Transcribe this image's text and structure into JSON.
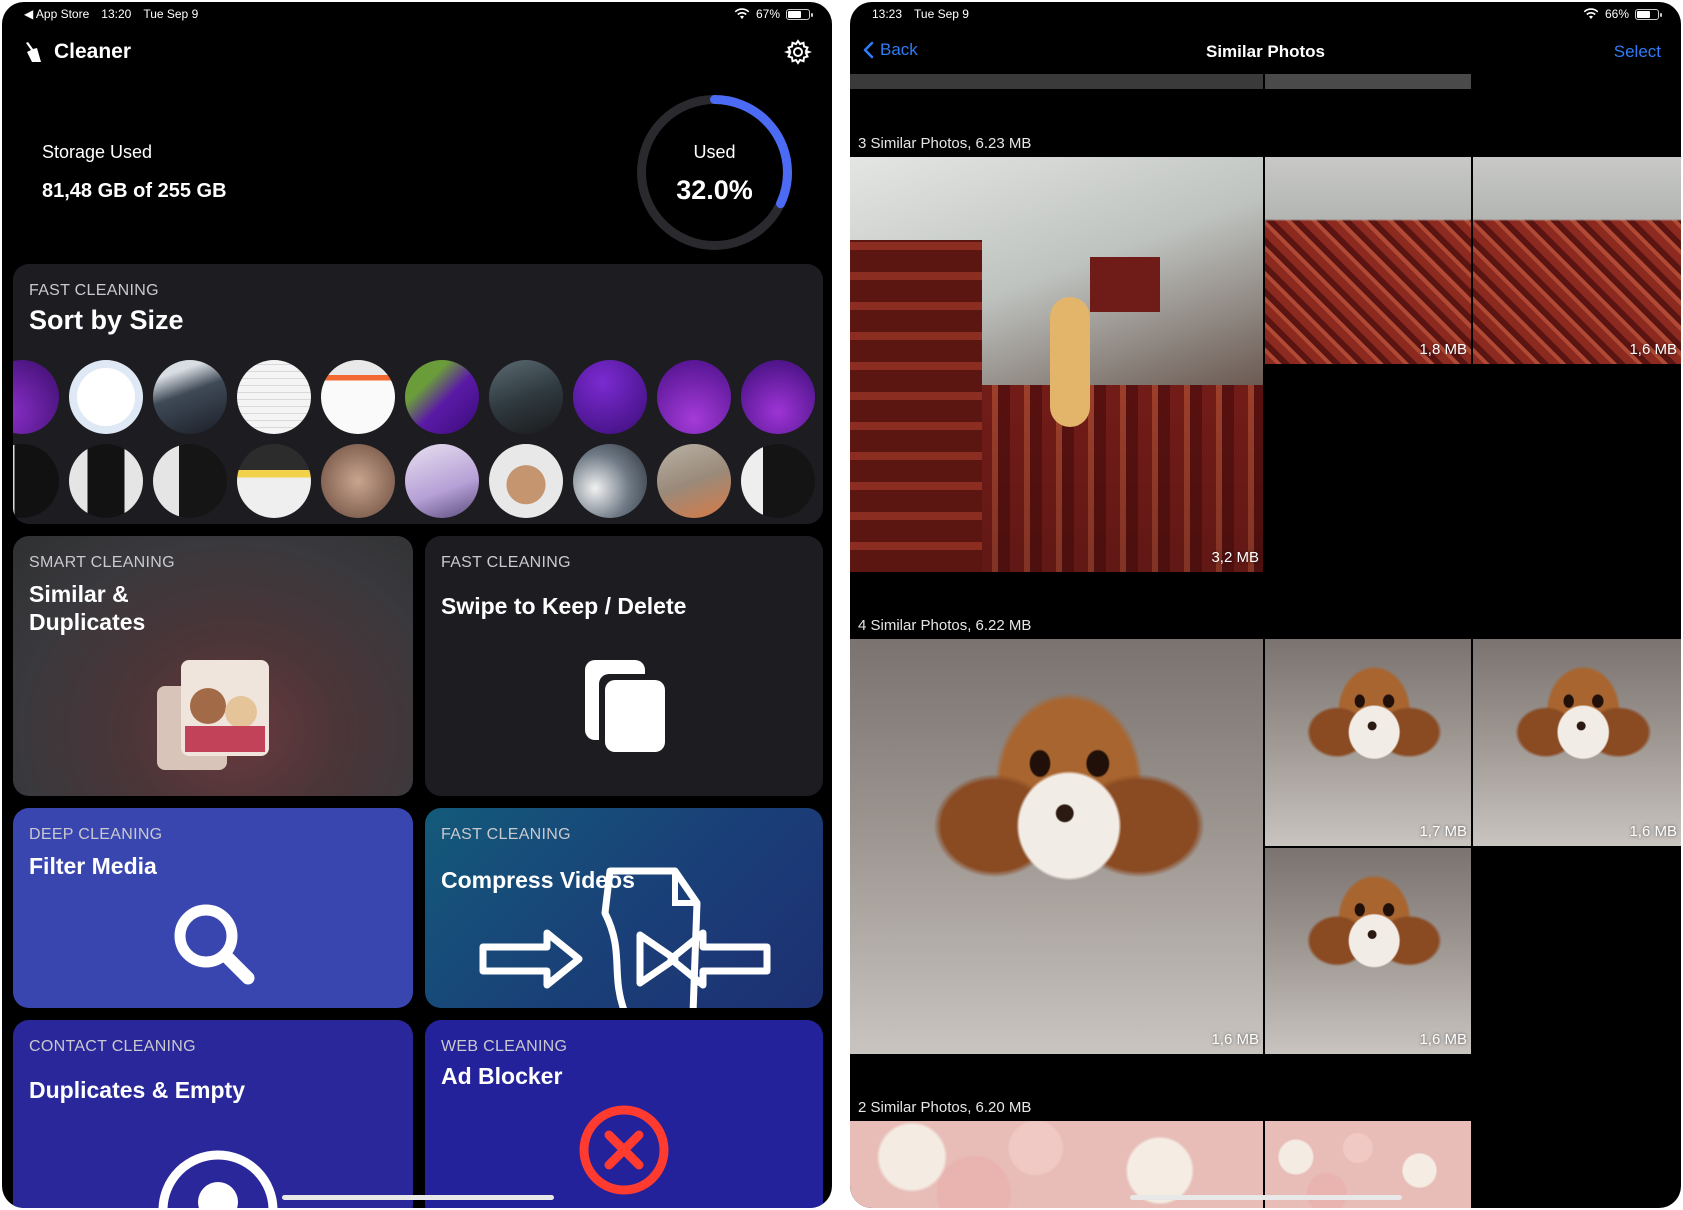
{
  "left": {
    "status": {
      "carrier": "◀ App Store",
      "time": "13:20",
      "date": "Tue Sep 9",
      "battery": "67%",
      "battery_level": 0.67
    },
    "app_title": "Cleaner",
    "storage": {
      "label": "Storage Used",
      "value": "81,48 GB of 255 GB",
      "ring_label": "Used",
      "ring_value": "32.0%",
      "fraction": 0.32
    },
    "sort_card": {
      "category": "FAST CLEANING",
      "title": "Sort by Size"
    },
    "similar_card": {
      "category": "SMART CLEANING",
      "title_line1": "Similar &",
      "title_line2": "Duplicates"
    },
    "swipe_card": {
      "category": "FAST CLEANING",
      "title": "Swipe to Keep / Delete"
    },
    "filter_card": {
      "category": "DEEP CLEANING",
      "title": "Filter Media"
    },
    "compress_card": {
      "category": "FAST CLEANING",
      "title": "Compress Videos"
    },
    "contact_card": {
      "category": "CONTACT CLEANING",
      "title": "Duplicates & Empty"
    },
    "adblock_card": {
      "category": "WEB CLEANING",
      "title": "Ad Blocker"
    }
  },
  "right": {
    "status": {
      "time": "13:23",
      "date": "Tue Sep 9",
      "battery": "66%",
      "battery_level": 0.66
    },
    "nav": {
      "back": "Back",
      "title": "Similar Photos",
      "select": "Select"
    },
    "groups": [
      {
        "label": "3 Similar Photos, 6.23 MB",
        "photos": [
          "3,2 MB",
          "1,8 MB",
          "1,6 MB"
        ]
      },
      {
        "label": "4 Similar Photos, 6.22 MB",
        "photos": [
          "1,6 MB",
          "1,7 MB",
          "1,6 MB",
          "1,6 MB"
        ]
      },
      {
        "label": "2 Similar Photos, 6.20 MB"
      }
    ]
  },
  "colors": {
    "accent_blue": "#2f7cf6",
    "ring_blue": "#4b6bf5",
    "adblock_red": "#ff3b30"
  }
}
